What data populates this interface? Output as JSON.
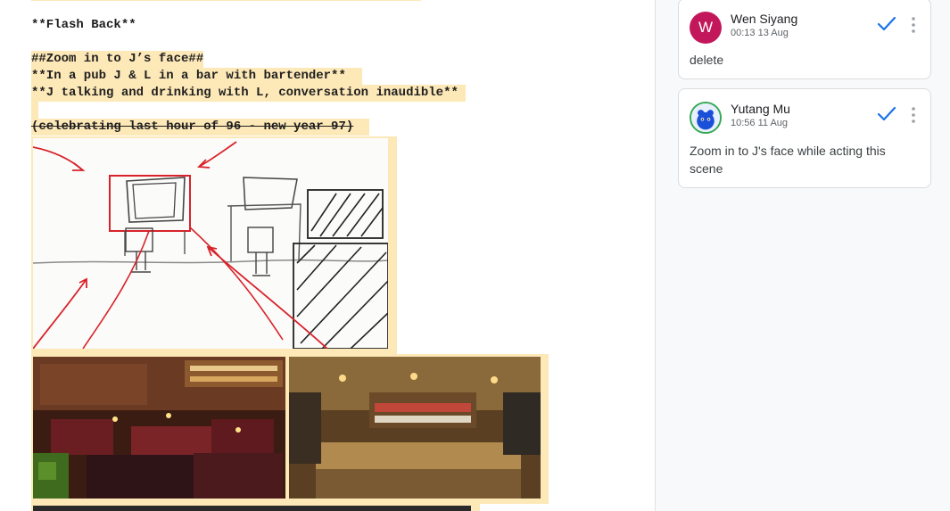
{
  "document": {
    "lines": [
      "**Flash Back**",
      "##Zoom in to J’s face##",
      "**In a pub J & L in a bar with bartender**",
      "**J talking and drinking with L, conversation inaudible**",
      "(celebrating last hour of 96 - new year 97)"
    ]
  },
  "comments": [
    {
      "author": "Wen Siyang",
      "initial": "W",
      "avatar_color": "#c2185b",
      "time": "00:13 13 Aug",
      "text": "delete"
    },
    {
      "author": "Yutang Mu",
      "time": "10:56 11 Aug",
      "text": "Zoom in to J's face while acting this scene"
    }
  ],
  "colors": {
    "highlight": "#fde8b8",
    "accent": "#1a73e8"
  }
}
